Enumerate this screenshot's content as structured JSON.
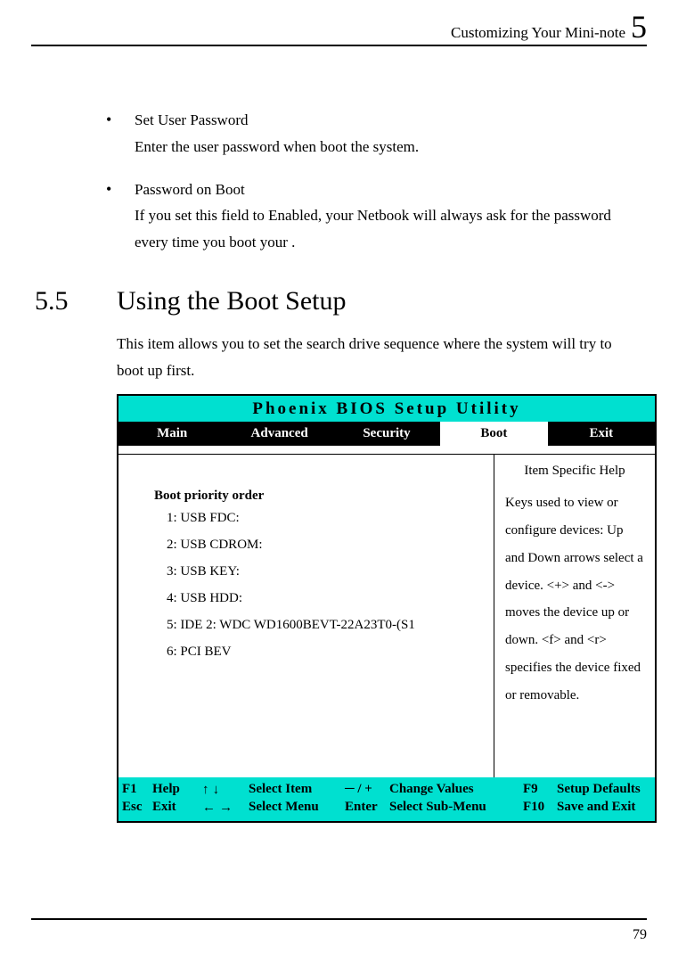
{
  "header": {
    "title": "Customizing Your Mini-note",
    "chapter": "5"
  },
  "bullets": [
    {
      "title": "Set User Password",
      "desc": "Enter the user password when boot the system."
    },
    {
      "title": "Password on Boot",
      "desc": "If  you set this field to Enabled, your Netbook will always ask for the password every time you boot your ."
    }
  ],
  "section": {
    "num": "5.5",
    "title": "Using the Boot Setup",
    "intro": "This item allows you to set the search drive sequence where the system will try to boot up first."
  },
  "bios": {
    "title": "Phoenix BIOS Setup Utility",
    "tabs": [
      "Main",
      "Advanced",
      "Security",
      "Boot",
      "Exit"
    ],
    "active_tab_index": 3,
    "boot_order_title": "Boot priority order",
    "boot_items": [
      "1: USB FDC:",
      "2: USB CDROM:",
      "3: USB KEY:",
      "4: USB HDD:",
      "5: IDE 2: WDC WD1600BEVT-22A23T0-(S1",
      "6: PCI BEV"
    ],
    "help": {
      "title": "Item Specific Help",
      "text": "Keys used to view or configure devices: Up and Down arrows select a device. <+> and <-> moves the device up or down. <f> and <r> specifies the device fixed or removable."
    },
    "footer": {
      "r1": {
        "k1": "F1",
        "k2": "Help",
        "arrows": "↑ ↓",
        "a1": "Select Item",
        "k3": "─ / +",
        "a2": "Change Values",
        "k4": "F9",
        "a3": "Setup Defaults"
      },
      "r2": {
        "k1": "Esc",
        "k2": "Exit",
        "arrows": "← →",
        "a1": "Select Menu",
        "k3": "Enter",
        "a2": "Select Sub-Menu",
        "k4": "F10",
        "a3": "Save and Exit"
      }
    }
  },
  "page_number": "79"
}
